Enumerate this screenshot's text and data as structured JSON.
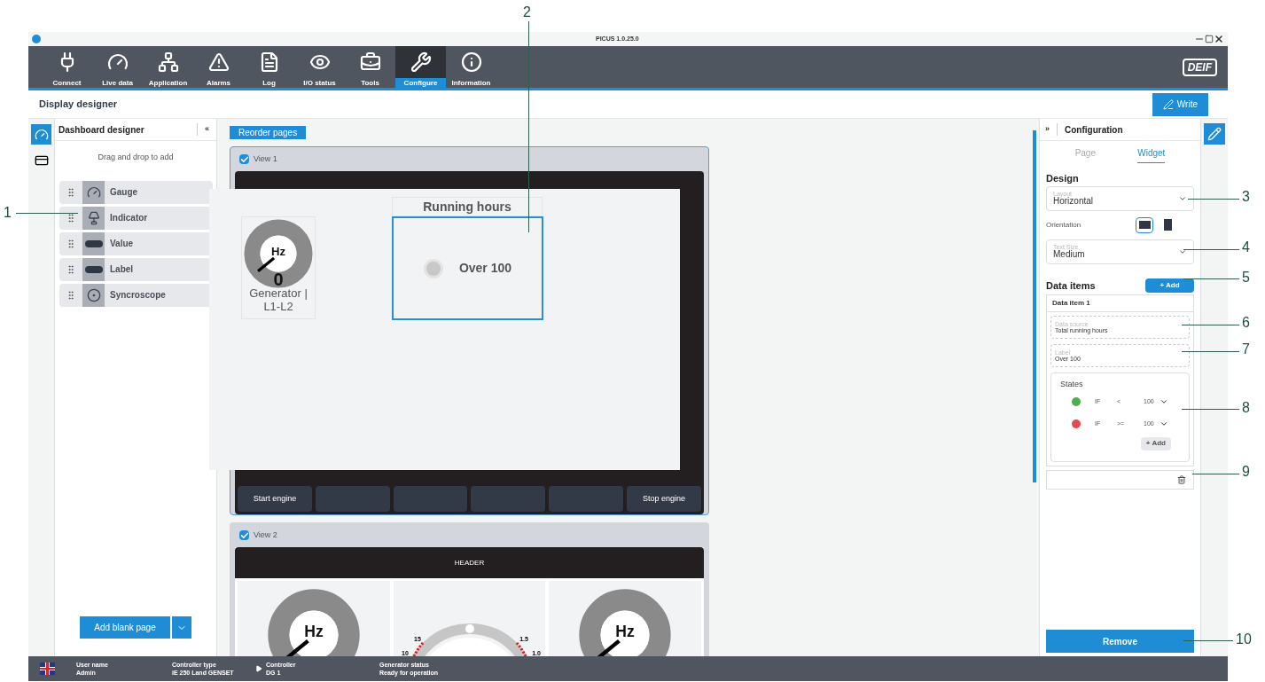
{
  "callouts": [
    {
      "label": "1"
    },
    {
      "label": "2"
    },
    {
      "label": "3"
    },
    {
      "label": "4"
    },
    {
      "label": "5"
    },
    {
      "label": "6"
    },
    {
      "label": "7"
    },
    {
      "label": "8"
    },
    {
      "label": "9"
    },
    {
      "label": "10"
    }
  ],
  "window": {
    "title": "PICUS 1.0.25.0",
    "logo": "DEIF"
  },
  "nav": [
    {
      "label": "Connect",
      "selected": false
    },
    {
      "label": "Live data",
      "selected": false
    },
    {
      "label": "Application",
      "selected": false
    },
    {
      "label": "Alarms",
      "selected": false
    },
    {
      "label": "Log",
      "selected": false
    },
    {
      "label": "I/O status",
      "selected": false
    },
    {
      "label": "Tools",
      "selected": false
    },
    {
      "label": "Configure",
      "selected": true
    },
    {
      "label": "Information",
      "selected": false
    }
  ],
  "page_header": {
    "title": "Display designer",
    "write_button": "Write"
  },
  "left_panel": {
    "title": "Dashboard designer",
    "collapse": "«",
    "hint": "Drag and drop to add",
    "add_page_button": "Add blank page",
    "widgets": [
      {
        "label": "Gauge",
        "kind": "gauge"
      },
      {
        "label": "Indicator",
        "kind": "indicator"
      },
      {
        "label": "Value",
        "kind": "value"
      },
      {
        "label": "Label",
        "kind": "label"
      },
      {
        "label": "Syncroscope",
        "kind": "syncroscope"
      }
    ]
  },
  "canvas": {
    "reorder_button": "Reorder pages",
    "views": [
      {
        "label": "View 1",
        "checked": true,
        "selected": true,
        "soft_keys": [
          {
            "kind": "labeled",
            "label": "Start engine"
          },
          {
            "kind": "blank"
          },
          {
            "kind": "blank"
          },
          {
            "kind": "blank"
          },
          {
            "kind": "blank"
          },
          {
            "kind": "labeled",
            "label": "Stop engine"
          }
        ]
      },
      {
        "label": "View 2",
        "checked": true,
        "selected": false,
        "header": "HEADER",
        "tiles": [
          {
            "kind": "gauge",
            "unit": "Hz"
          },
          {
            "kind": "syncroscope",
            "scale_labels": [
              "15",
              "10",
              "1.5",
              "1.0"
            ]
          },
          {
            "kind": "gauge",
            "unit": "Hz"
          }
        ]
      }
    ]
  },
  "drag_preview": {
    "gauge": {
      "unit": "Hz",
      "value": "0",
      "label": "Generator | L1-L2"
    },
    "indicator": {
      "title": "Running hours",
      "label": "Over 100",
      "selected": true
    }
  },
  "config_panel": {
    "expand": "»",
    "title": "Configuration",
    "tabs": [
      {
        "label": "Page",
        "selected": false
      },
      {
        "label": "Widget",
        "selected": true
      }
    ],
    "design_heading": "Design",
    "layout": {
      "label": "Layout",
      "value": "Horizontal"
    },
    "orientation": {
      "label": "Orientation",
      "options": [
        {
          "kind": "horizontal",
          "selected": true
        },
        {
          "kind": "vertical",
          "selected": false
        }
      ]
    },
    "text_size": {
      "label": "Text Size",
      "value": "Medium"
    },
    "data_items_heading": "Data items",
    "add_button": "+ Add",
    "items": [
      {
        "title": "Data item 1",
        "data_source": {
          "label": "Data source",
          "value": "Total running hours"
        },
        "label": {
          "label": "Label",
          "value": "Over 100"
        },
        "states": {
          "title": "States",
          "add_button": "+ Add",
          "rows": [
            {
              "color": "#4caf50",
              "condition": "IF",
              "operator": "<",
              "value": "100"
            },
            {
              "color": "#e5484d",
              "condition": "IF",
              "operator": ">=",
              "value": "100"
            }
          ]
        }
      }
    ],
    "remove_button": "Remove"
  },
  "status_bar": [
    {
      "kind": "plain",
      "label": "User name",
      "value": "Admin"
    },
    {
      "kind": "plain",
      "label": "Controller type",
      "value": "iE 250 Land GENSET"
    },
    {
      "kind": "arrow",
      "label": "Controller",
      "value": "DG 1"
    },
    {
      "kind": "plain",
      "label": "Generator status",
      "value": "Ready for operation"
    }
  ]
}
